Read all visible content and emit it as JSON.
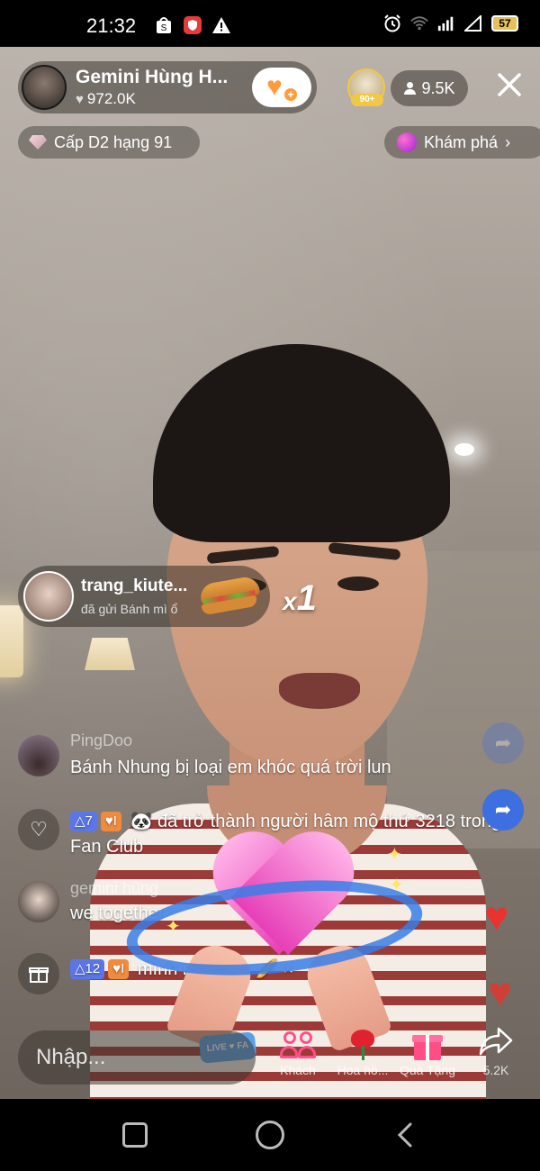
{
  "status_bar": {
    "time": "21:32",
    "battery": "57",
    "icons_left": [
      "shopee-icon",
      "shield-app-icon",
      "warning-icon"
    ],
    "icons_right": [
      "alarm-icon",
      "wifi-icon",
      "signal-icon",
      "signal-empty-icon",
      "battery-icon"
    ]
  },
  "host": {
    "name": "Gemini Hùng H...",
    "likes": "972.0K"
  },
  "top_viewer": {
    "badge": "90+"
  },
  "viewers": {
    "count": "9.5K"
  },
  "rank": {
    "label": "Cấp D2 hạng 91"
  },
  "explore": {
    "label": "Khám phá"
  },
  "gift": {
    "user": "trang_kiute...",
    "text": "đã gửi Bánh mì ổ",
    "count_x": "x",
    "count_n": "1"
  },
  "comments": [
    {
      "user": "PingDoo",
      "text": "Bánh Nhung bị loại em khóc quá trời lun"
    },
    {
      "level": "7",
      "fan": "I",
      "text": "đã trở thành người hâm mộ thứ 3218 trong Fan Club"
    },
    {
      "user": "gemini hùng",
      "text": "we together"
    },
    {
      "level": "12",
      "fan": "I",
      "text": "mình nổi tiếng",
      "extra": "×"
    }
  ],
  "wristband_text": "LIVE ♥ FA",
  "input": {
    "placeholder": "Nhập..."
  },
  "actions": [
    {
      "label": "Khách",
      "icon": "guests-icon"
    },
    {
      "label": "Hoa hồ...",
      "icon": "rose-icon"
    },
    {
      "label": "Quà Tặng",
      "icon": "gift-icon"
    },
    {
      "label": "5.2K",
      "icon": "share-icon"
    }
  ],
  "colors": {
    "accent_pink": "#ff4f8b",
    "follow_orange": "#ff9b3d",
    "level_badge": "#5b76e6",
    "fan_badge": "#f08a3e",
    "heart_red": "#e8332e"
  }
}
